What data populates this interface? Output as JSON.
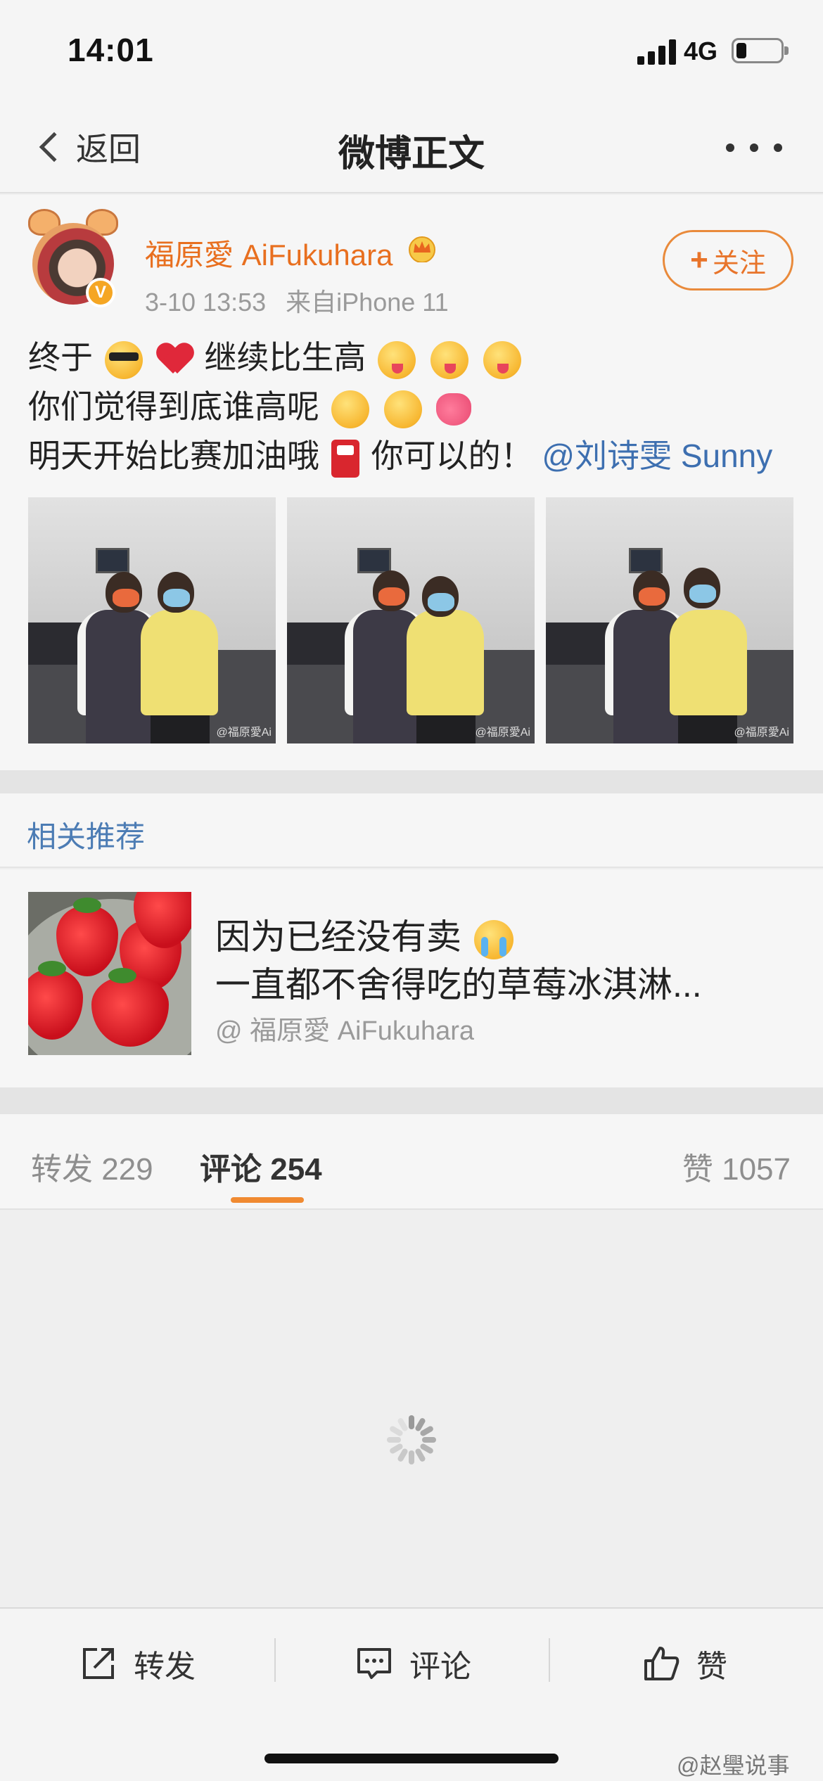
{
  "status_bar": {
    "time": "14:01",
    "network": "4G"
  },
  "nav": {
    "back_label": "返回",
    "title": "微博正文"
  },
  "post": {
    "username": "福原愛 AiFukuhara",
    "time": "3-10 13:53",
    "source": "来自iPhone 11",
    "follow_label": "关注",
    "text": {
      "line1_a": "终于",
      "line1_b": "继续比生高",
      "line2": "你们觉得到底谁高呢",
      "line3_a": "明天开始比赛加油哦",
      "line3_b": "你可以的！",
      "mention": "@刘诗雯 Sunny"
    },
    "photo_watermark": "@福原愛Ai"
  },
  "related": {
    "heading": "相关推荐",
    "line1": "因为已经没有卖",
    "line2": "一直都不舍得吃的草莓冰淇淋...",
    "source": "@ 福原愛 AiFukuhara"
  },
  "tabs": [
    {
      "label": "转发 229"
    },
    {
      "label": "评论 254"
    },
    {
      "label": "赞 1057"
    }
  ],
  "bottom_bar": {
    "repost": "转发",
    "comment": "评论",
    "like": "赞"
  },
  "corner_watermark": "@赵璺说事",
  "colors": {
    "accent": "#e86f1f",
    "link": "#3d6fb0",
    "tab_indicator": "#f08a31"
  }
}
